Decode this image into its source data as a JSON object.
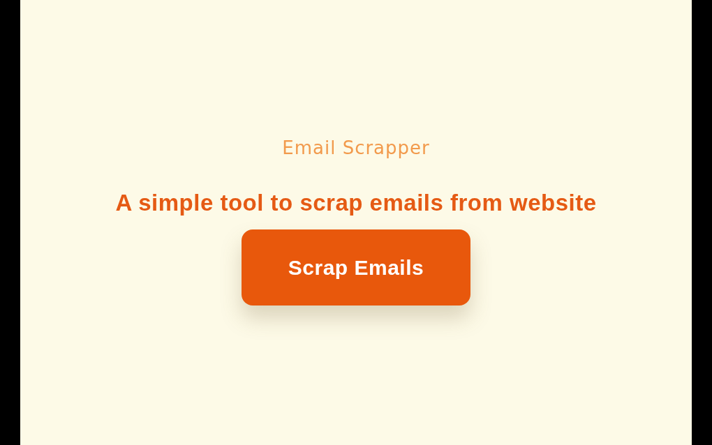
{
  "app_name": "Email Scrapper",
  "tagline": "A simple tool to scrap emails from website",
  "button": {
    "label": "Scrap Emails"
  }
}
